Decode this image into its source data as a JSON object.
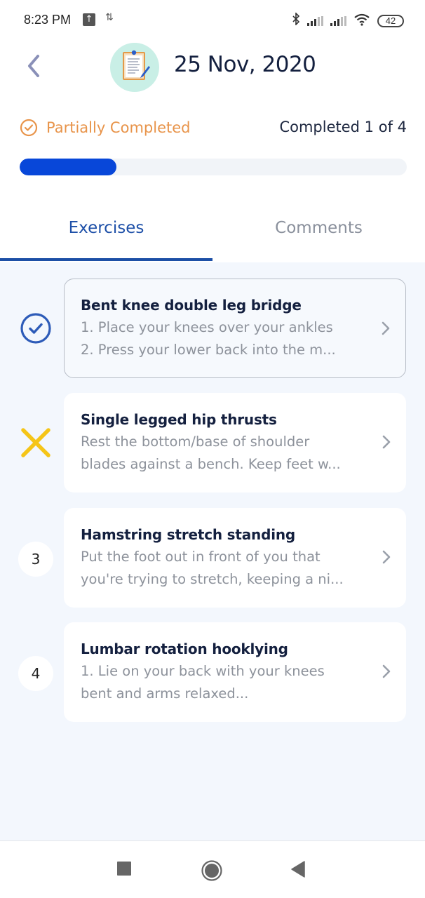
{
  "status_bar": {
    "time": "8:23 PM",
    "upload_icon": "arrow-up-box-icon",
    "data_icon": "data-transfer-icon",
    "bluetooth_icon": "bluetooth-icon",
    "signal_icons": [
      "signal-icon",
      "signal-icon"
    ],
    "wifi_icon": "wifi-icon",
    "battery_level": "42"
  },
  "header": {
    "back_icon": "chevron-left-icon",
    "avatar_icon": "clipboard-icon",
    "title": "25 Nov, 2020"
  },
  "summary": {
    "status_label": "Partially Completed",
    "status_icon": "check-circle-icon",
    "completed_text": "Completed 1 of 4",
    "completed": 1,
    "total": 4,
    "progress_fraction": 0.25
  },
  "colors": {
    "accent": "#1e50a8",
    "progress_fill": "#0847d9",
    "partial_status": "#e8944a",
    "skipped": "#f5c518",
    "done": "#2d5bb8"
  },
  "tabs": [
    {
      "label": "Exercises",
      "active": true
    },
    {
      "label": "Comments",
      "active": false
    }
  ],
  "exercises": [
    {
      "status": "done",
      "marker": "check-circle-icon",
      "title": "Bent knee double leg bridge",
      "desc_line1": "1. Place your knees over your ankles",
      "desc_line2": "2. Press your lower back into the m..."
    },
    {
      "status": "skipped",
      "marker": "x-icon",
      "title": "Single legged hip thrusts",
      "desc_line1": "Rest the bottom/base of shoulder",
      "desc_line2": "blades against a bench. Keep feet w..."
    },
    {
      "status": "pending",
      "marker": "3",
      "title": "Hamstring stretch standing",
      "desc_line1": "Put the foot out in front of you that",
      "desc_line2": "you're trying to stretch, keeping a ni..."
    },
    {
      "status": "pending",
      "marker": "4",
      "title": "Lumbar rotation hooklying",
      "desc_line1": "1. Lie on your back with your knees",
      "desc_line2": "bent and arms relaxed..."
    }
  ],
  "nav": {
    "recents_icon": "square-icon",
    "home_icon": "circle-icon",
    "back_icon": "triangle-back-icon"
  }
}
